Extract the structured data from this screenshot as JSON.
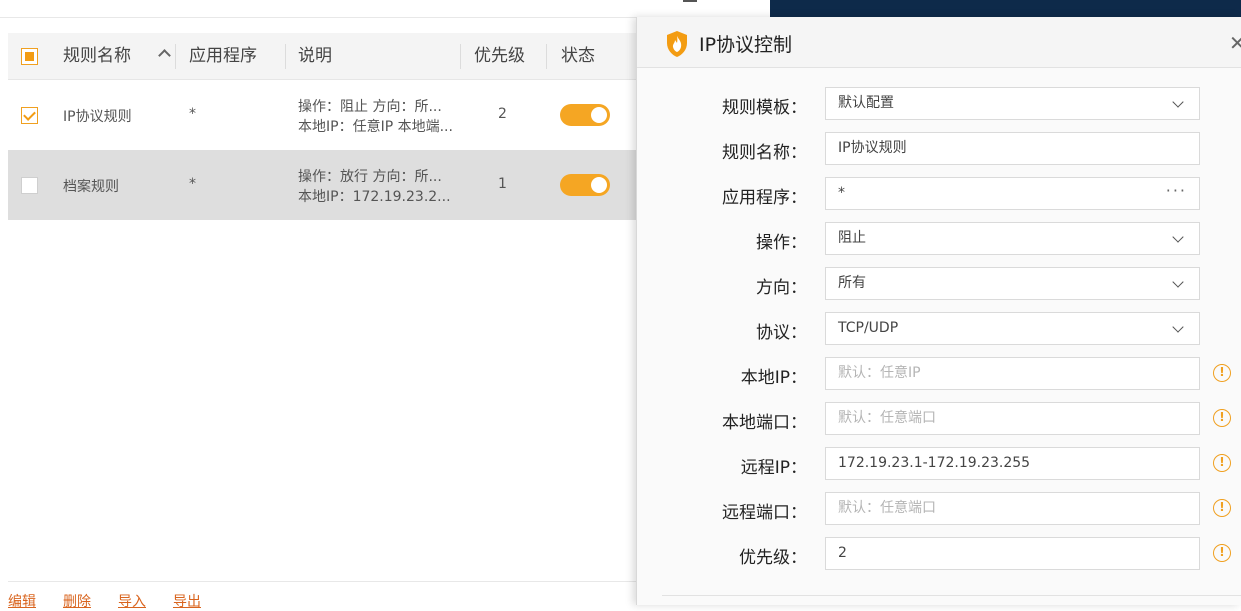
{
  "table": {
    "headers": {
      "name": "规则名称",
      "app": "应用程序",
      "desc": "说明",
      "priority": "优先级",
      "status": "状态"
    },
    "rows": [
      {
        "name": "IP协议规则",
        "app": "*",
        "desc_line1": "操作：阻止 方向：所...",
        "desc_line2": "本地IP：任意IP 本地端...",
        "priority": "2",
        "checked": true,
        "enabled": true
      },
      {
        "name": "档案规则",
        "app": "*",
        "desc_line1": "操作：放行 方向：所...",
        "desc_line2": "本地IP：172.19.23.2...",
        "priority": "1",
        "checked": false,
        "enabled": true
      }
    ]
  },
  "footer": {
    "edit": "编辑",
    "delete": "删除",
    "import": "导入",
    "export": "导出"
  },
  "dialog": {
    "title": "IP协议控制",
    "close_icon": "close-icon",
    "fields": {
      "template": {
        "label": "规则模板：",
        "value": "默认配置"
      },
      "rule_name": {
        "label": "规则名称：",
        "value": "IP协议规则"
      },
      "app": {
        "label": "应用程序：",
        "value": "*"
      },
      "action": {
        "label": "操作：",
        "value": "阻止"
      },
      "direction": {
        "label": "方向：",
        "value": "所有"
      },
      "protocol": {
        "label": "协议：",
        "value": "TCP/UDP"
      },
      "local_ip": {
        "label": "本地IP：",
        "placeholder": "默认：任意IP"
      },
      "local_port": {
        "label": "本地端口：",
        "placeholder": "默认：任意端口"
      },
      "remote_ip": {
        "label": "远程IP：",
        "value": "172.19.23.1-172.19.23.255"
      },
      "remote_port": {
        "label": "远程端口：",
        "placeholder": "默认：任意端口"
      },
      "priority": {
        "label": "优先级：",
        "value": "2"
      }
    }
  },
  "colors": {
    "accent": "#f5a623",
    "link": "#d9641e",
    "desktop": "#0e2a4a"
  }
}
